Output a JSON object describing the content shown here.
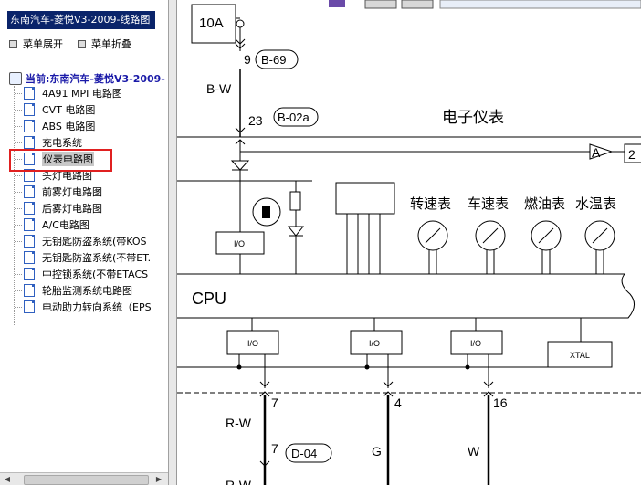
{
  "sidebar": {
    "title": "东南汽车-菱悦V3-2009-线路图",
    "expand_label": "菜单展开",
    "collapse_label": "菜单折叠",
    "root_label": "当前:东南汽车-菱悦V3-2009-",
    "items": [
      {
        "label": "4A91 MPI 电路图"
      },
      {
        "label": "CVT 电路图"
      },
      {
        "label": "ABS 电路图"
      },
      {
        "label": "充电系统"
      },
      {
        "label": "仪表电路图",
        "selected": true
      },
      {
        "label": "头灯电路图"
      },
      {
        "label": "前雾灯电路图"
      },
      {
        "label": "后雾灯电路图"
      },
      {
        "label": "A/C电路图"
      },
      {
        "label": "无钥匙防盗系统(带KOS"
      },
      {
        "label": "无钥匙防盗系统(不带ET."
      },
      {
        "label": "中控锁系统(不带ETACS"
      },
      {
        "label": "轮胎监测系统电路图"
      },
      {
        "label": "电动助力转向系统（EPS"
      }
    ]
  },
  "diagram": {
    "fuse": "10A",
    "pin_top": "9",
    "conn_top": "B-69",
    "wire_top": "B-W",
    "pin_mid": "23",
    "conn_mid": "B-02a",
    "cluster_title": "电子仪表",
    "ref_a": "A",
    "ref_page": "2",
    "gauges": [
      "转速表",
      "车速表",
      "燃油表",
      "水温表"
    ],
    "io_label": "I/O",
    "cpu_label": "CPU",
    "xtal_label": "XTAL",
    "bottom_pins": [
      "7",
      "4",
      "16"
    ],
    "wire_rw": "R-W",
    "pin_lower": "7",
    "conn_lower": "D-04",
    "wire_g": "G",
    "wire_w": "W",
    "wire_rw2": "R-W"
  },
  "colors": {
    "title_bg": "#0a246a",
    "selection_box": "#e02020",
    "root_text": "#1a1aa8"
  }
}
